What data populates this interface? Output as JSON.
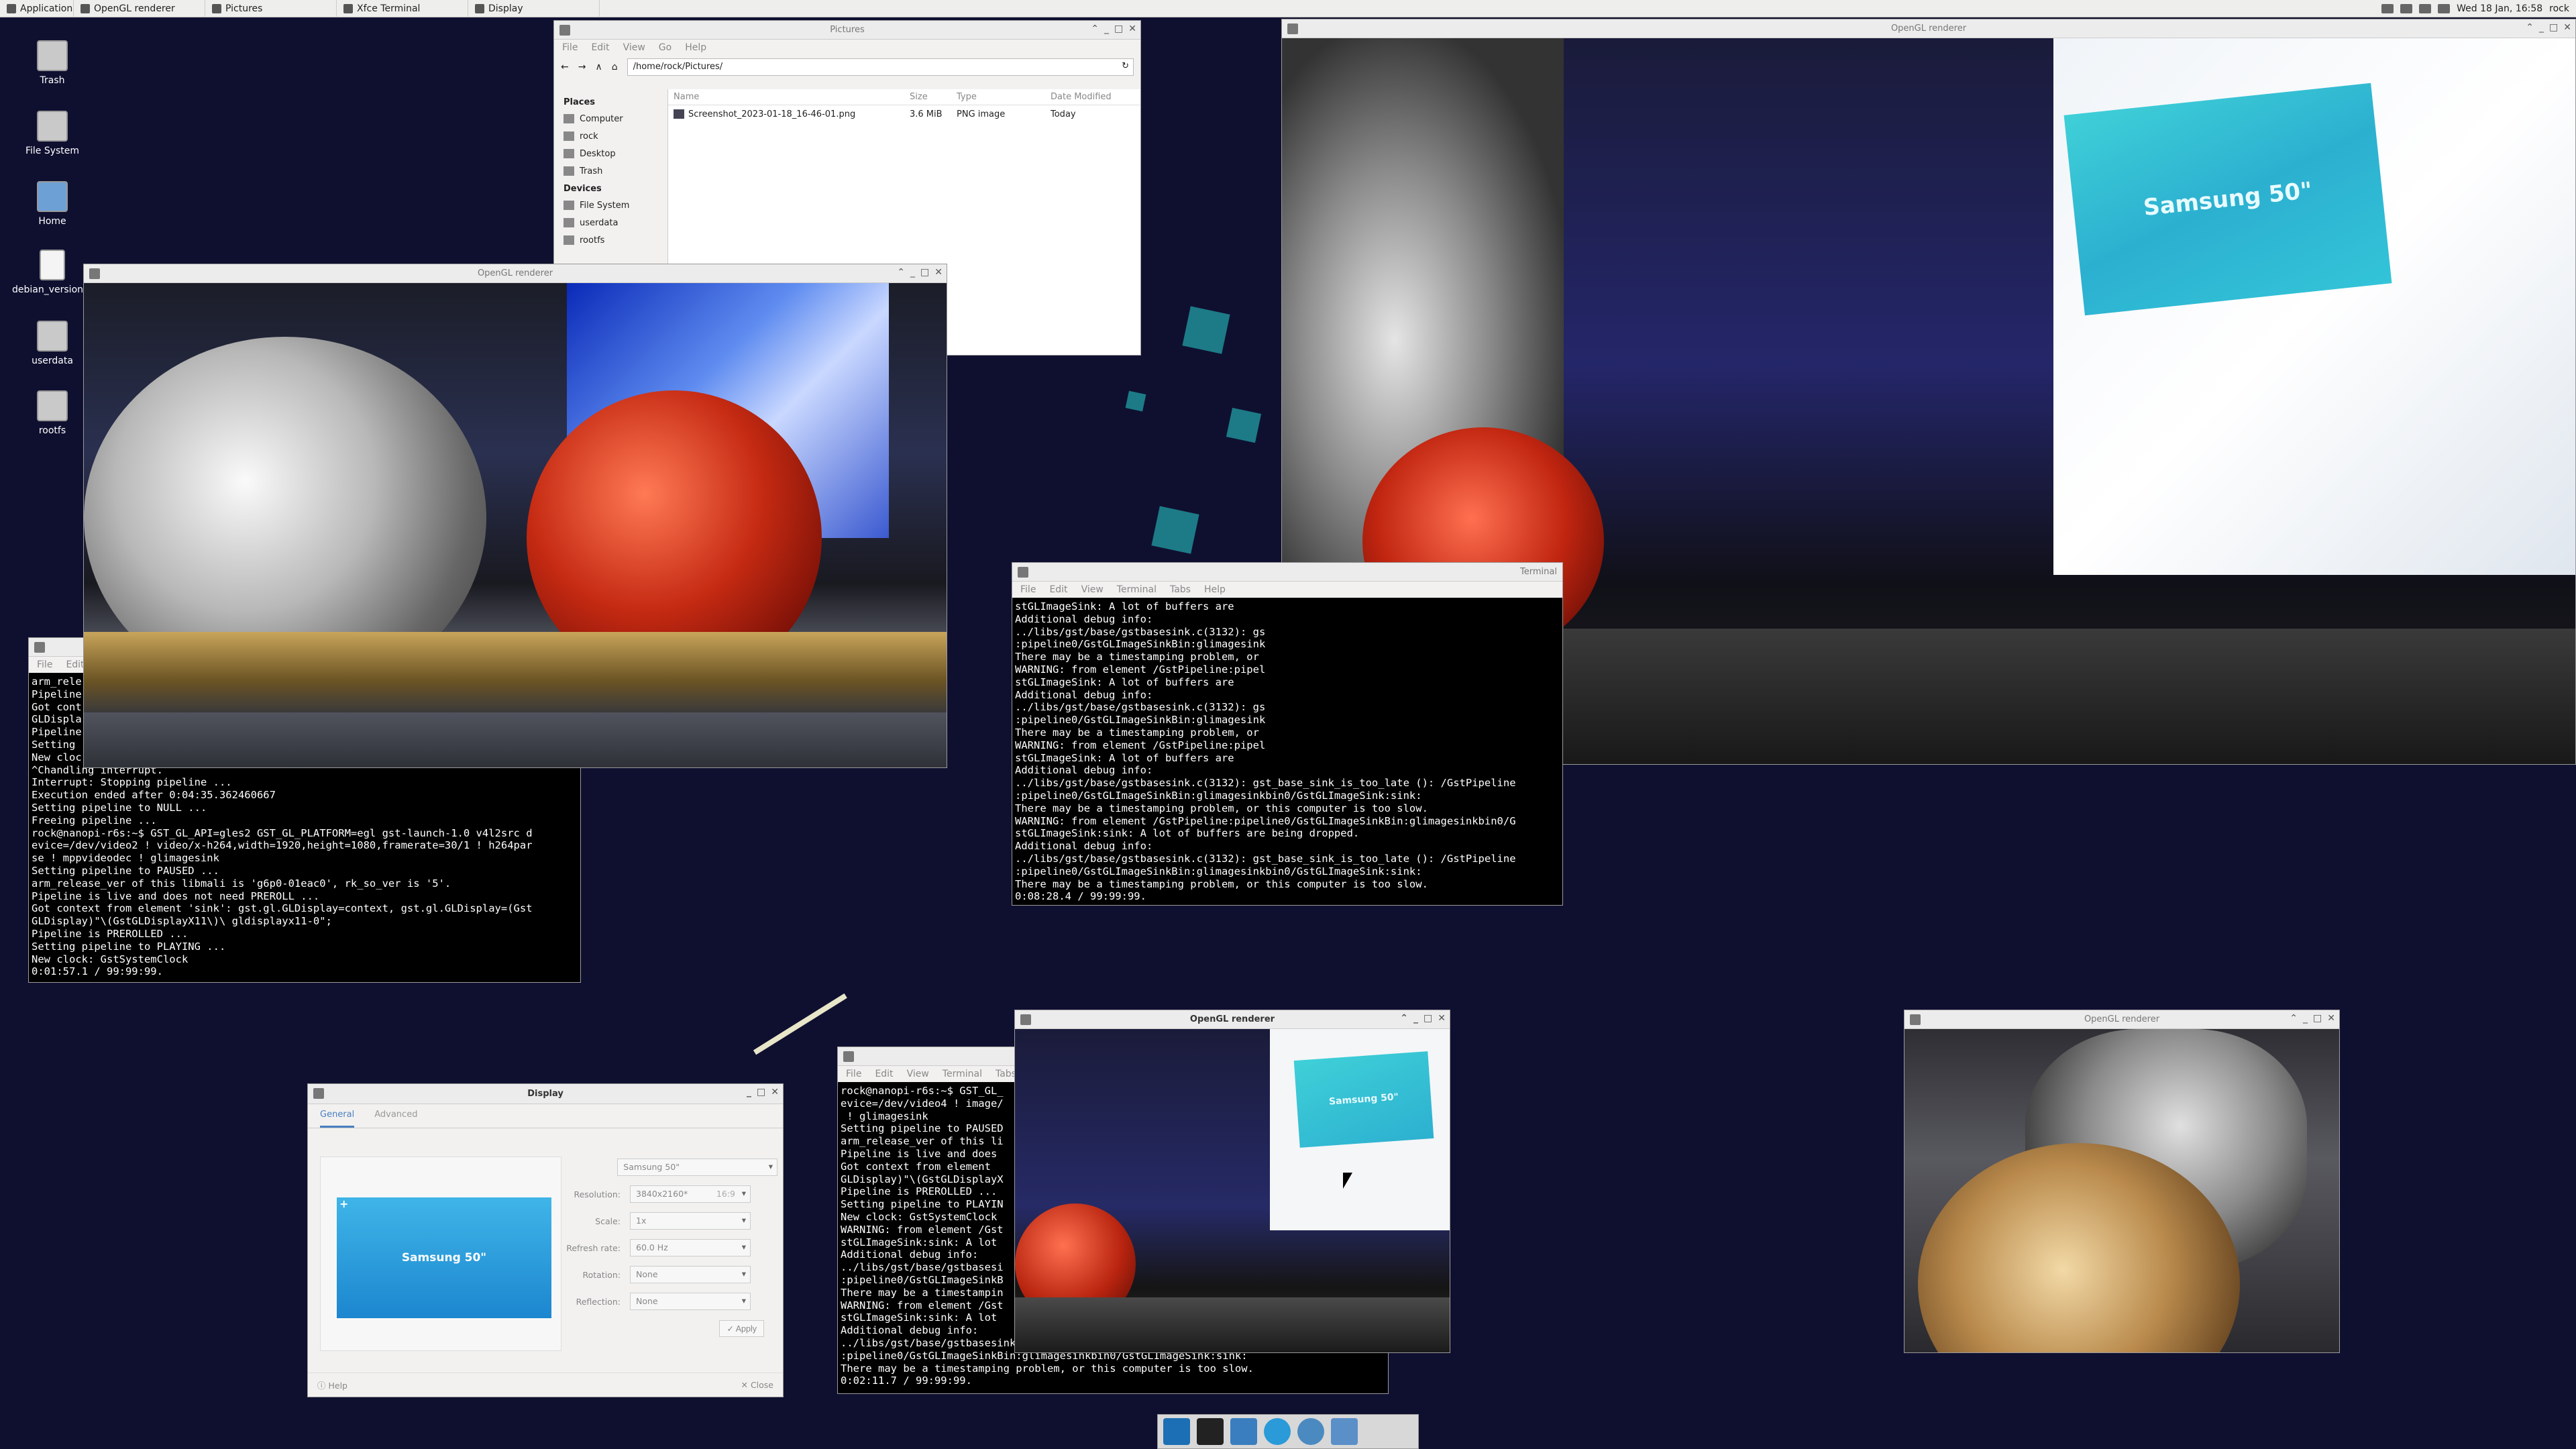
{
  "top_panel": {
    "applications": "Applications",
    "tasks": [
      "OpenGL renderer",
      "Pictures",
      "Xfce Terminal",
      "Display"
    ],
    "clock": "Wed 18 Jan, 16:58",
    "user": "rock"
  },
  "desktop_icons": [
    "Trash",
    "File System",
    "Home",
    "debian_version.txt",
    "userdata",
    "rootfs"
  ],
  "file_manager": {
    "title": "Pictures",
    "menu": [
      "File",
      "Edit",
      "View",
      "Go",
      "Help"
    ],
    "path": "/home/rock/Pictures/",
    "places_header": "Places",
    "places": [
      "Computer",
      "rock",
      "Desktop",
      "Trash"
    ],
    "devices_header": "Devices",
    "devices": [
      "File System",
      "userdata",
      "rootfs"
    ],
    "columns": [
      "Name",
      "Size",
      "Type",
      "Date Modified"
    ],
    "files": [
      {
        "name": "Screenshot_2023-01-18_16-46-01.png",
        "size": "3.6 MiB",
        "type": "PNG image",
        "date": "Today"
      }
    ]
  },
  "gl_windows": {
    "title": "OpenGL renderer",
    "monitor_label": "Samsung 50\""
  },
  "terminal_left": {
    "menu": [
      "File",
      "Edit"
    ],
    "text": "arm_rele\nPipeline\nGot cont\nGLDispla\nPipeline\nSetting \nNew cloc\n^Chandling interrupt.\nInterrupt: Stopping pipeline ...\nExecution ended after 0:04:35.362460667\nSetting pipeline to NULL ...\nFreeing pipeline ...\nrock@nanopi-r6s:~$ GST_GL_API=gles2 GST_GL_PLATFORM=egl gst-launch-1.0 v4l2src d\nevice=/dev/video2 ! video/x-h264,width=1920,height=1080,framerate=30/1 ! h264par\nse ! mppvideodec ! glimagesink\nSetting pipeline to PAUSED ...\narm_release_ver of this libmali is 'g6p0-01eac0', rk_so_ver is '5'.\nPipeline is live and does not need PREROLL ...\nGot context from element 'sink': gst.gl.GLDisplay=context, gst.gl.GLDisplay=(Gst\nGLDisplay)\"\\(GstGLDisplayX11\\)\\ gldisplayx11-0\";\nPipeline is PREROLLED ...\nSetting pipeline to PLAYING ...\nNew clock: GstSystemClock\n0:01:57.1 / 99:99:99."
  },
  "terminal_mid": {
    "title": "Terminal",
    "menu": [
      "File",
      "Edit",
      "View",
      "Terminal",
      "Tabs",
      "Help"
    ],
    "text": "stGLImageSink: A lot of buffers are\nAdditional debug info:\n../libs/gst/base/gstbasesink.c(3132): gs\n:pipeline0/GstGLImageSinkBin:glimagesink\nThere may be a timestamping problem, or\nWARNING: from element /GstPipeline:pipel\nstGLImageSink: A lot of buffers are\nAdditional debug info:\n../libs/gst/base/gstbasesink.c(3132): gs\n:pipeline0/GstGLImageSinkBin:glimagesink\nThere may be a timestamping problem, or\nWARNING: from element /GstPipeline:pipel\nstGLImageSink: A lot of buffers are\nAdditional debug info:\n../libs/gst/base/gstbasesink.c(3132): gst_base_sink_is_too_late (): /GstPipeline\n:pipeline0/GstGLImageSinkBin:glimagesinkbin0/GstGLImageSink:sink:\nThere may be a timestamping problem, or this computer is too slow.\nWARNING: from element /GstPipeline:pipeline0/GstGLImageSinkBin:glimagesinkbin0/G\nstGLImageSink:sink: A lot of buffers are being dropped.\nAdditional debug info:\n../libs/gst/base/gstbasesink.c(3132): gst_base_sink_is_too_late (): /GstPipeline\n:pipeline0/GstGLImageSinkBin:glimagesinkbin0/GstGLImageSink:sink:\nThere may be a timestamping problem, or this computer is too slow.\n0:08:28.4 / 99:99:99."
  },
  "terminal_bottom": {
    "menu": [
      "File",
      "Edit",
      "View",
      "Terminal",
      "Tabs"
    ],
    "text": "rock@nanopi-r6s:~$ GST_GL_\nevice=/dev/video4 ! image/\n ! glimagesink\nSetting pipeline to PAUSED\narm_release_ver of this li\nPipeline is live and does\nGot context from element\nGLDisplay)\"\\(GstGLDisplayX\nPipeline is PREROLLED ...\nSetting pipeline to PLAYIN\nNew clock: GstSystemClock\nWARNING: from element /Gst\nstGLImageSink:sink: A lot\nAdditional debug info:\n../libs/gst/base/gstbasesi\n:pipeline0/GstGLImageSinkB\nThere may be a timestampin\nWARNING: from element /Gst\nstGLImageSink:sink: A lot\nAdditional debug info:\n../libs/gst/base/gstbasesink.c(3132): gst_base_sink_is_too_late (): /GstPipeline\n:pipeline0/GstGLImageSinkBin:glimagesinkbin0/GstGLImageSink:sink:\nThere may be a timestamping problem, or this computer is too slow.\n0:02:11.7 / 99:99:99."
  },
  "display_dialog": {
    "title": "Display",
    "tabs": [
      "General",
      "Advanced"
    ],
    "monitor_select": "Samsung 50\"",
    "monitor_name": "Samsung 50\"",
    "fields": [
      {
        "label": "Resolution:",
        "value": "3840x2160*",
        "extra": "16:9"
      },
      {
        "label": "Scale:",
        "value": "1x"
      },
      {
        "label": "Refresh rate:",
        "value": "60.0 Hz"
      },
      {
        "label": "Rotation:",
        "value": "None"
      },
      {
        "label": "Reflection:",
        "value": "None"
      }
    ],
    "apply": "Apply",
    "help": "Help",
    "close": "Close"
  },
  "colors": {
    "desktop": "#0f1030",
    "accent": "#4a7fc0",
    "teal": "#1e8e96"
  }
}
